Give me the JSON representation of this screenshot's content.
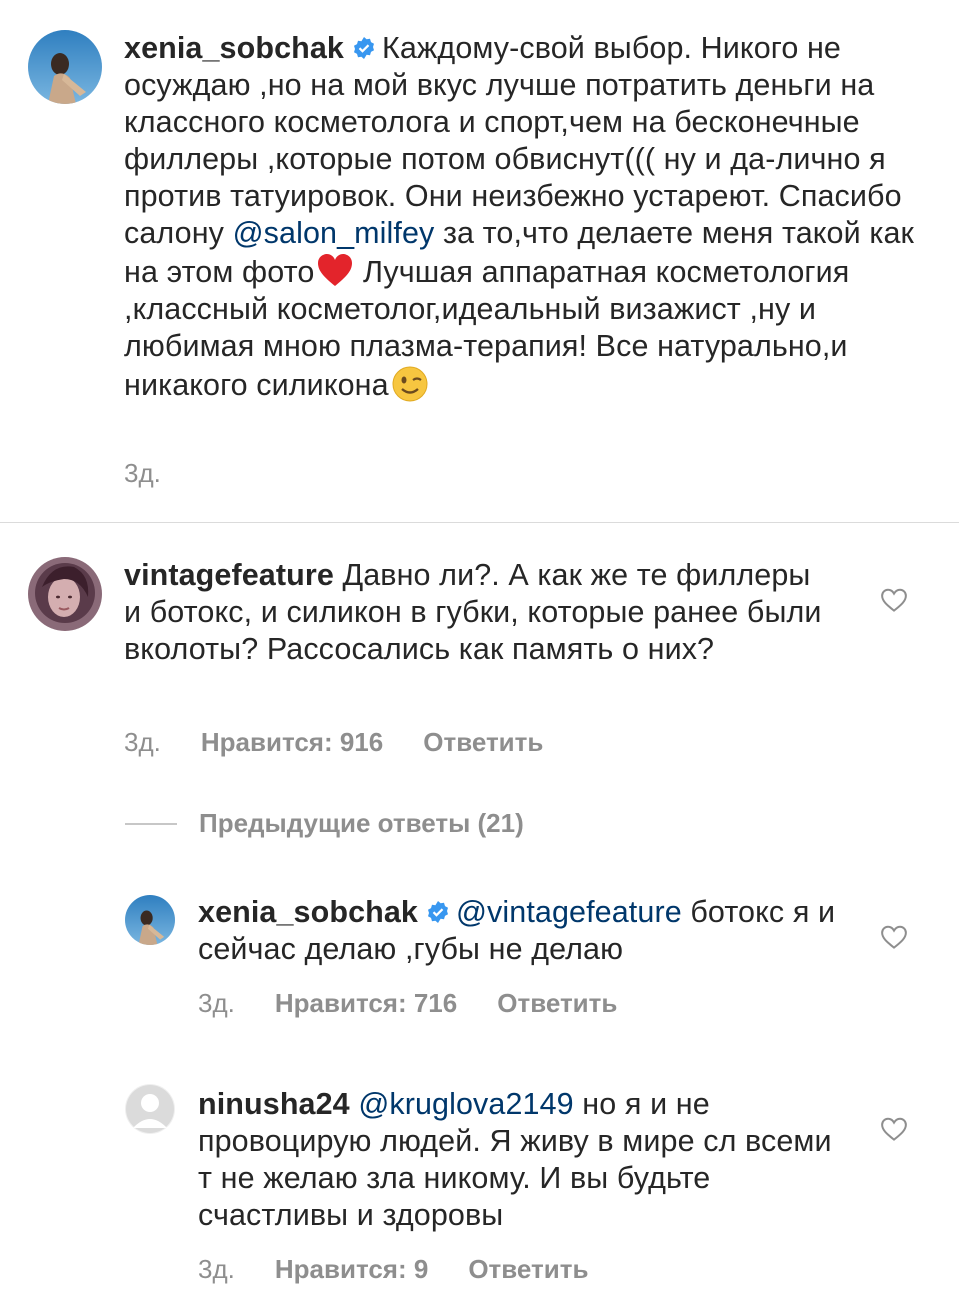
{
  "comments": [
    {
      "username": "xenia_sobchak",
      "verified": true,
      "text_before": "Каждому-свой выбор. Никого не осуждаю ,но на мой вкус лучше потратить деньги на классного косметолога и спорт,чем на бесконечные филлеры ,которые потом обвиснут((( ну и да-лично я против татуировок. Они неизбежно устареют. Спасибо салону ",
      "mention": "@salon_milfey",
      "text_middle": " за то,что делаете меня такой как на этом фото",
      "text_after": " Лучшая аппаратная косметология ,классный косметолог,идеальный визажист ,ну и любимая мною плазма-терапия! Все натурально,и никакого силикона",
      "time": "3д."
    },
    {
      "username": "vintagefeature",
      "text": "Давно ли?. А как же те филлеры и ботокс, и силикон в губки, которые ранее были вколоты? Рассосались как память о них?",
      "time": "3д.",
      "likes": "Нравится: 916",
      "reply": "Ответить"
    }
  ],
  "view_replies": "Предыдущие ответы (21)",
  "replies": [
    {
      "username": "xenia_sobchak",
      "verified": true,
      "mention": "@vintagefeature",
      "text": " ботокс я и сейчас делаю ,губы не делаю",
      "time": "3д.",
      "likes": "Нравится: 716",
      "reply": "Ответить"
    },
    {
      "username": "ninusha24",
      "mention": "@kruglova2149",
      "text": " но я и не провоцирую людей. Я живу в мире сл всеми т не желаю зла никому. И вы будьте счастливы и здоровы",
      "time": "3д.",
      "likes": "Нравится: 9",
      "reply": "Ответить"
    }
  ],
  "colors": {
    "text": "#262626",
    "meta": "#8e8e8e",
    "mention": "#00376b",
    "verified": "#3897f0",
    "divider": "#dbdbdb"
  }
}
